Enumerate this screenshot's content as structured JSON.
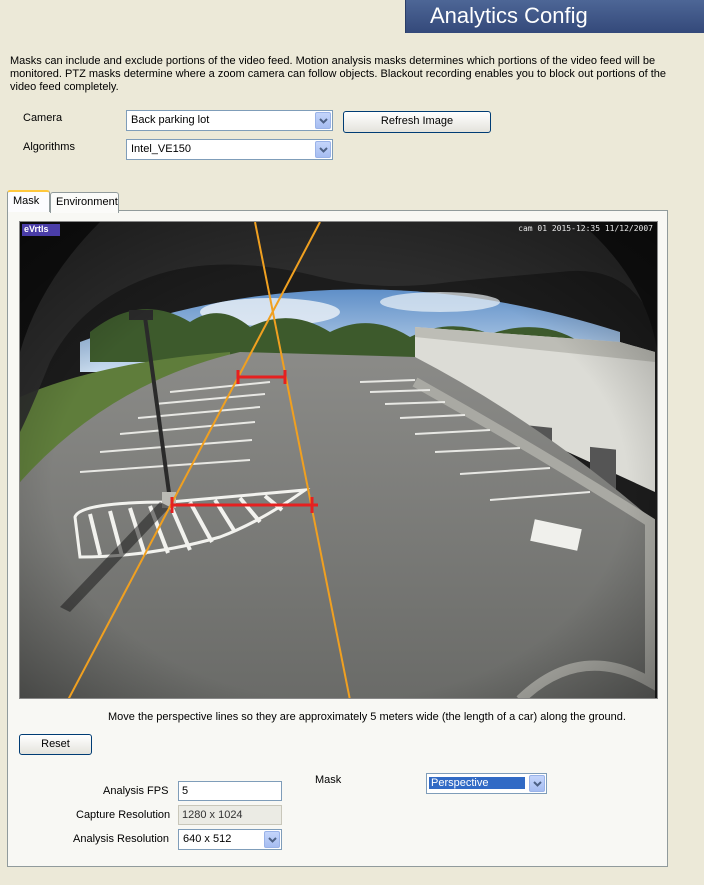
{
  "header": {
    "title": "Analytics Config"
  },
  "description": "Masks can include and exclude portions of the video feed.  Motion analysis masks determines which portions of the video feed will be monitored.  PTZ masks determine where a zoom camera can follow objects.  Blackout recording enables you to block out portions of the video feed completely.",
  "camera": {
    "label": "Camera",
    "value": "Back parking lot"
  },
  "algorithms": {
    "label": "Algorithms",
    "value": "Intel_VE150"
  },
  "refresh_button": "Refresh Image",
  "tabs": [
    {
      "label": "Mask",
      "active": true
    },
    {
      "label": "Environment",
      "active": false
    }
  ],
  "video": {
    "logo_text": "eVrtls",
    "timestamp": "cam 01 2015-12:35 11/12/2007"
  },
  "hint": "Move the perspective lines so they are approximately 5 meters wide (the length of a car) along the ground.",
  "reset_button": "Reset",
  "analysis_fps": {
    "label": "Analysis FPS",
    "value": "5"
  },
  "capture_resolution": {
    "label": "Capture Resolution",
    "value": "1280 x 1024"
  },
  "analysis_resolution": {
    "label": "Analysis Resolution",
    "value": "640 x 512"
  },
  "mask": {
    "label": "Mask",
    "value": "Perspective"
  },
  "colors": {
    "header_bar": "#3d5487",
    "perspective_lines": "#f0a020",
    "width_markers": "#e62020",
    "selection": "#316ac5"
  }
}
